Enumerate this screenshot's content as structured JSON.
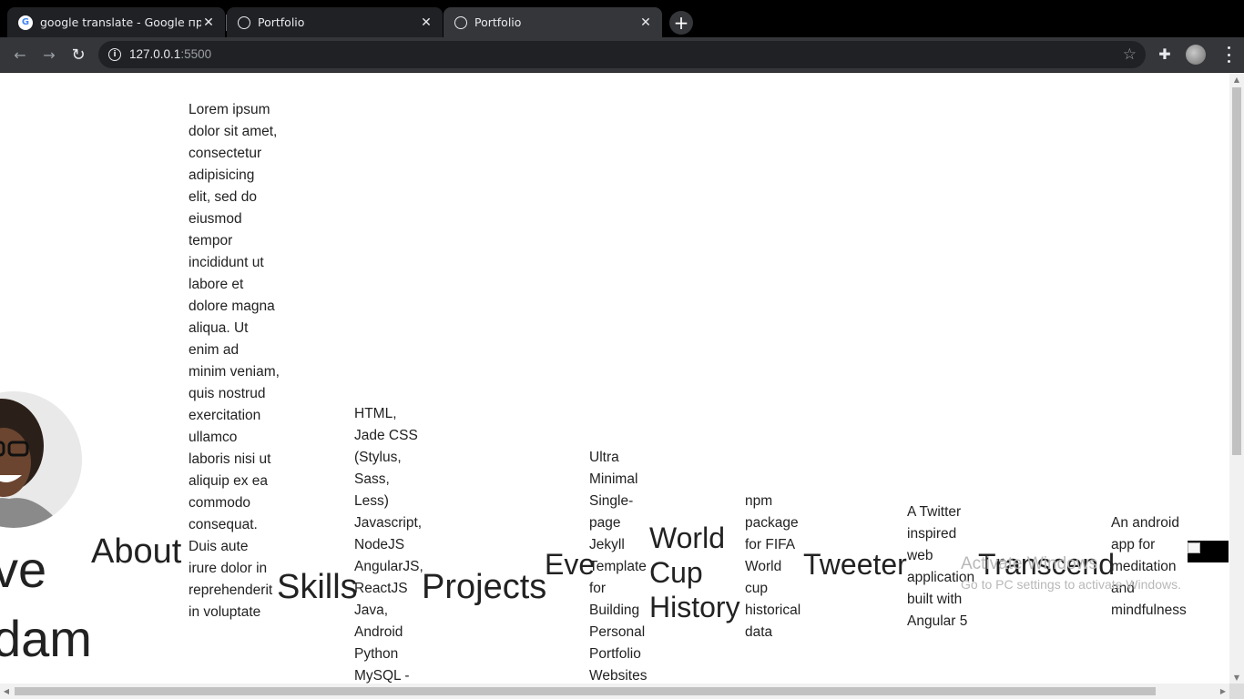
{
  "browser": {
    "tabs": [
      {
        "title": "google translate - Google претр",
        "favicon": "google-icon"
      },
      {
        "title": "Portfolio",
        "favicon": "globe-icon"
      },
      {
        "title": "Portfolio",
        "favicon": "globe-icon"
      }
    ],
    "url_host": "127.0.0.1",
    "url_port": ":5500"
  },
  "page": {
    "name_line1": "ve",
    "name_line2": "dam",
    "about_heading": "About",
    "about_text": "Lorem ipsum dolor sit amet, consectetur adipisicing elit, sed do eiusmod tempor incididunt ut labore et dolore magna aliqua. Ut enim ad minim veniam, quis nostrud exercitation ullamco laboris nisi ut aliquip ex ea commodo consequat. Duis aute irure dolor in reprehenderit in voluptate",
    "skills_heading": "Skills",
    "skills_text": "HTML, Jade CSS (Stylus, Sass, Less) Javascript, NodeJS AngularJS, ReactJS Java, Android Python MySQL -",
    "projects_heading": "Projects",
    "projects": [
      {
        "title": "Eve",
        "description": "Ultra Minimal Single-page Jekyll Template for Building Personal Portfolio Websites"
      },
      {
        "title": "World Cup History",
        "description": "npm package for FIFA World cup historical data"
      },
      {
        "title": "Tweeter",
        "description": "A Twitter inspired web application built with Angular 5"
      },
      {
        "title": "Transcend",
        "description": "An android app for meditation and mindfulness"
      }
    ]
  },
  "watermark": {
    "line1": "Activate Windows",
    "line2": "Go to PC settings to activate Windows."
  }
}
